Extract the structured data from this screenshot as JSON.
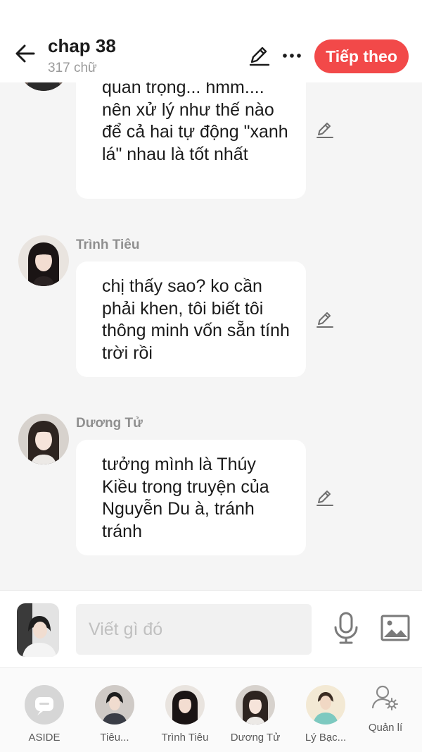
{
  "header": {
    "title": "chap 38",
    "subtitle": "317 chữ",
    "next_label": "Tiếp theo"
  },
  "messages": [
    {
      "speaker": "",
      "text": "quan trọng... hmm.... nên xử lý như thế nào để cả hai tự động \"xanh lá\" nhau là tốt nhất"
    },
    {
      "speaker": "Trình Tiêu",
      "text": "chị thấy sao? ko cần phải khen, tôi biết tôi thông minh vốn sẵn tính trời rồi"
    },
    {
      "speaker": "Dương Tử",
      "text": "tưởng mình là Thúy Kiều trong truyện của Nguyễn Du à, tránh tránh"
    }
  ],
  "composer": {
    "placeholder": "Viết gì đó"
  },
  "bottom_nav": [
    {
      "label": "ASIDE"
    },
    {
      "label": "Tiêu..."
    },
    {
      "label": "Trình Tiêu"
    },
    {
      "label": "Dương Tử"
    },
    {
      "label": "Lý Bạc..."
    },
    {
      "label": "Quản lí"
    }
  ],
  "colors": {
    "accent": "#f24949",
    "background": "#f5f5f5",
    "bubble": "#ffffff",
    "speaker_text": "#8f8f8f"
  }
}
